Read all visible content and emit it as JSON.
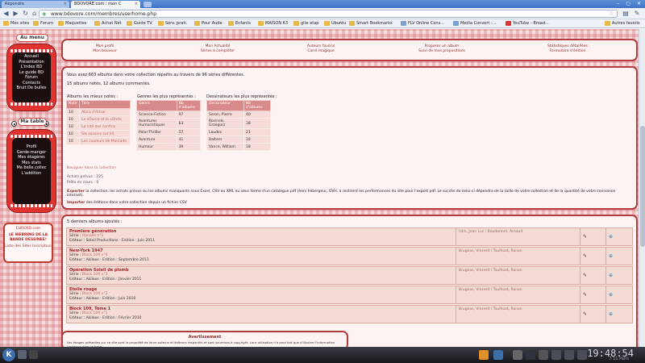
{
  "browser": {
    "tabs": [
      {
        "label": "Répondre",
        "active": false
      },
      {
        "label": "BDOVORE.com : mon C",
        "active": true
      }
    ],
    "url": "www.bdovore.com/membres/userhome.php",
    "bookmarks": [
      "Mes sites",
      "Forum",
      "Maquettes",
      "Achat Net",
      "Guide TV",
      "Serv. prati.",
      "Pour Aude",
      "Enfants",
      "MAISON 63",
      "gite etap",
      "Ubuntu",
      "Smart Bookmarks",
      "FLV Online Conv...",
      "Media Convert -...",
      "YouTube - Broad...",
      "Autres favoris"
    ]
  },
  "sidebar": {
    "menu_title": "Au menu",
    "menu_items": [
      "Accueil",
      "Présentation",
      "L'index BD",
      "Le guide BD",
      "Forum",
      "Contacts",
      "Bruit De bulles"
    ],
    "table_title": "Ma table",
    "table_items": [
      "Profil",
      "Garde-manger",
      "Mes étagères",
      "Mes stats",
      "Ma belle collec",
      "L'addition"
    ],
    "promo": {
      "site": "EURO6D.com",
      "headline": "LE WEBRING DE LA BANDE DESSINEE!",
      "links": "Liste des Sites Inscription"
    }
  },
  "topnav": [
    {
      "title": "Mon profil",
      "sub": "Mon bouvour"
    },
    {
      "title": "Mon Actualité",
      "sub": "Séries à compléter"
    },
    {
      "title": "Auteurs favoris",
      "sub": "Carré magique"
    },
    {
      "title": "Proposer un album",
      "sub": "Suivi de mes propositions"
    },
    {
      "title": "Statistiques détaillées",
      "sub": "Formulaire d'édition"
    }
  ],
  "stats": {
    "summary": "Vous avez 663 albums dans votre collection répartis au travers de 96 séries différentes.",
    "rated": "15 albums notés, 12 albums commentés.",
    "best_header": "Albums les mieux notés :",
    "best_cols": [
      "Note",
      "Titre"
    ],
    "best_rows": [
      [
        "10",
        "Akira d'Aitsal"
      ],
      [
        "10",
        "Le sOurce et la sOnde"
      ],
      [
        "10",
        "La cité des confins"
      ],
      [
        "10",
        "Six saisons sur ll0"
      ],
      [
        "10",
        "Les couleurs de Marcade"
      ]
    ],
    "genres_header": "Genres les plus représentés :",
    "genres_cols": [
      "Genre",
      "Nb d'albums"
    ],
    "genres_rows": [
      [
        "Science-Fiction",
        "97"
      ],
      [
        "Aventures Humoristiques",
        "63"
      ],
      [
        "Polar-Thriller",
        "57"
      ],
      [
        "Aventure",
        "41"
      ],
      [
        "Humour",
        "39"
      ]
    ],
    "artists_header": "Dessinateurs les plus représentés :",
    "artists_cols": [
      "Dessinateur",
      "Nb d'albums"
    ],
    "artists_rows": [
      [
        "Seron, Pierre",
        "40"
      ],
      [
        "Rosinski, Grzegorz",
        "38"
      ],
      [
        "Laudec",
        "21"
      ],
      [
        "Baltern",
        "19"
      ],
      [
        "Vance, William",
        "18"
      ]
    ],
    "navigate": "Naviguer dans la collection",
    "achats": "Achats prévus : 225",
    "prets": "Prêts en cours : 0",
    "export_label": "Exporter",
    "export_text": "la collection, les achats prévus ou les albums manquants sous Excel, CSV ou XML ou sous forme d'un catalogue pdf (hors hébergeur, OVH, a restreint les performances du site pour l'export pdf. Le succès de celui-ci dépendra de la taille de votre collection et de la quantité de votre connexion internet).",
    "import_label": "Importer",
    "import_text": "des éditions dans votre collection depuis un fichier CSV"
  },
  "latest": {
    "header": "5 derniers albums ajoutés :",
    "entries": [
      {
        "title": "Première génération",
        "serie": "Hanelle n°1",
        "editor": "Soleil Productions - Edition : Juin 2011",
        "authors": "Istin, Jean Luc / Boudonnet, Arnaud"
      },
      {
        "title": "New-York 1947",
        "serie": "Block 109 n°4",
        "editor": "Akileos - Edition : Septembre 2011",
        "authors": "Brugeas, Vincent / Toulhoat, Ronan"
      },
      {
        "title": "Opération Soleil de plomb",
        "serie": "Block 109 n°3",
        "editor": "Akileos - Edition : Janvier 2011",
        "authors": "Brugeas, Vincent / Toulhoat, Ronan"
      },
      {
        "title": "Etoile rouge",
        "serie": "Block 109 n°2",
        "editor": "Akileos - Edition : Juin 2010",
        "authors": "Brugeas, Vincent / Toulhoat, Ronan"
      },
      {
        "title": "Block 109, Tome 1",
        "serie": "Block 109 n°1",
        "editor": "Akileos - Edition : Février 2010",
        "authors": "Brugeas, Vincent / Toulhoat, Ronan"
      }
    ]
  },
  "warning": {
    "title": "Avertissement",
    "text": "Les images présentes sur ce site sont la propriété de leurs auteurs et éditeurs respectifs et sont soumises à copyright. Leur utilisation n'a pour but que d'illustrer l'information contenue dans la base"
  },
  "taskbar": {
    "clock": "19:48:54",
    "date": "7 11 Paris"
  }
}
